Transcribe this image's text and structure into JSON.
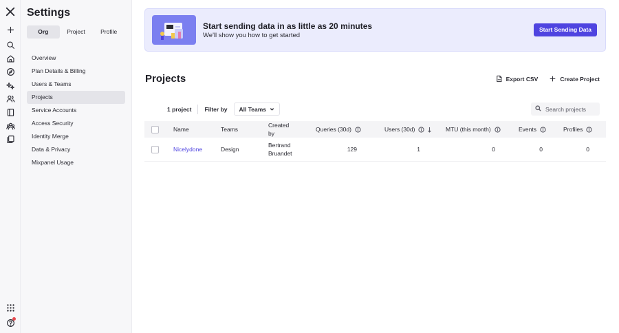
{
  "rail": {
    "icons": [
      "mixpanel-logo-icon",
      "plus-icon",
      "search-icon",
      "home-icon",
      "compass-icon",
      "sparkle-icon",
      "users-icon",
      "book-icon",
      "community-icon",
      "boards-icon",
      "apps-grid-icon",
      "help-icon"
    ]
  },
  "settings": {
    "title": "Settings",
    "tabs": [
      {
        "label": "Org",
        "active": true
      },
      {
        "label": "Project",
        "active": false
      },
      {
        "label": "Profile",
        "active": false
      }
    ],
    "nav": [
      {
        "label": "Overview"
      },
      {
        "label": "Plan Details & Billing"
      },
      {
        "label": "Users & Teams"
      },
      {
        "label": "Projects",
        "active": true
      },
      {
        "label": "Service Accounts"
      },
      {
        "label": "Access Security"
      },
      {
        "label": "Identity Merge"
      },
      {
        "label": "Data & Privacy"
      },
      {
        "label": "Mixpanel Usage"
      }
    ]
  },
  "banner": {
    "title": "Start sending data in as little as 20 minutes",
    "subtitle": "We'll show you how to get started",
    "cta": "Start Sending Data"
  },
  "page": {
    "title": "Projects",
    "export_label": "Export CSV",
    "create_label": "Create Project"
  },
  "toolbar": {
    "count": "1 project",
    "filter_label": "Filter by",
    "filter_value": "All Teams",
    "search_placeholder": "Search projects"
  },
  "table": {
    "headers": {
      "name": "Name",
      "teams": "Teams",
      "created_by": "Created by",
      "queries": "Queries (30d)",
      "users": "Users (30d)",
      "mtu": "MTU (this month)",
      "events": "Events",
      "profiles": "Profiles"
    },
    "rows": [
      {
        "name": "Nicelydone",
        "teams": "Design",
        "created_by": "Bertrand Bruandet",
        "queries": "129",
        "users": "1",
        "mtu": "0",
        "events": "0",
        "profiles": "0"
      }
    ]
  },
  "colors": {
    "accent": "#4f44e0",
    "banner_bg": "#ebecfd",
    "sidebar_bg": "#f7f7f9",
    "notification": "#e5484d"
  }
}
